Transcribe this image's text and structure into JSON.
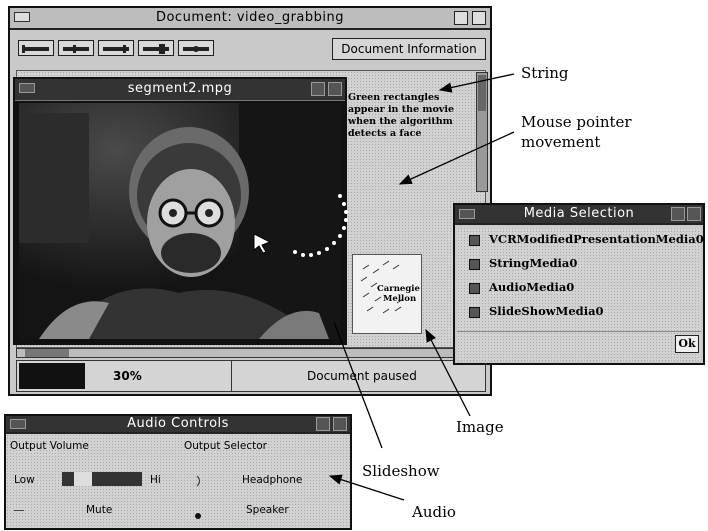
{
  "main_window": {
    "title": "Document: video_grabbing",
    "doc_info_button": "Document Information",
    "status_percent": "30%",
    "status_text": "Document paused"
  },
  "video_window": {
    "title": "segment2.mpg"
  },
  "string_media": {
    "text": "Green rectangles appear in the movie when the algorithm detects a face"
  },
  "image_media": {
    "line1": "Carnegie",
    "line2": "Mellon"
  },
  "media_selection": {
    "title": "Media Selection",
    "items": [
      {
        "label": "VCRModifiedPresentationMedia0",
        "checked": true
      },
      {
        "label": "StringMedia0",
        "checked": true
      },
      {
        "label": "AudioMedia0",
        "checked": true
      },
      {
        "label": "SlideShowMedia0",
        "checked": true
      }
    ],
    "ok_button": "Ok"
  },
  "audio_controls": {
    "title": "Audio Controls",
    "output_volume_label": "Output Volume",
    "output_selector_label": "Output Selector",
    "low_label": "Low",
    "hi_label": "Hi",
    "headphone_label": "Headphone",
    "mute_label": "Mute",
    "speaker_label": "Speaker",
    "selected_output": "Speaker"
  },
  "annotations": {
    "string": "String",
    "mouse_line1": "Mouse pointer",
    "mouse_line2": "movement",
    "image": "Image",
    "slideshow": "Slideshow",
    "audio": "Audio"
  }
}
